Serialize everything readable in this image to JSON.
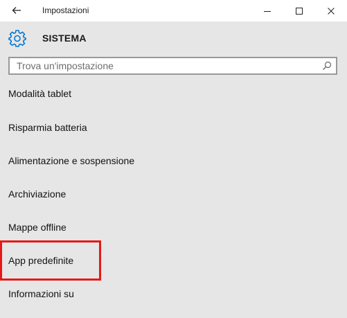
{
  "window": {
    "title": "Impostazioni"
  },
  "header": {
    "section_title": "SISTEMA"
  },
  "search": {
    "placeholder": "Trova un'impostazione"
  },
  "menu": {
    "items": [
      {
        "label": "Modalità tablet"
      },
      {
        "label": "Risparmia batteria"
      },
      {
        "label": "Alimentazione e sospensione"
      },
      {
        "label": "Archiviazione"
      },
      {
        "label": "Mappe offline"
      },
      {
        "label": "App predefinite"
      },
      {
        "label": "Informazioni su"
      }
    ]
  },
  "colors": {
    "accent": "#0078d7",
    "highlight": "#e81818",
    "background": "#e6e6e6"
  },
  "icons": {
    "back": "back-arrow-icon",
    "minimize": "minimize-icon",
    "maximize": "maximize-icon",
    "close": "close-icon",
    "settings": "gear-icon",
    "search": "search-icon"
  }
}
